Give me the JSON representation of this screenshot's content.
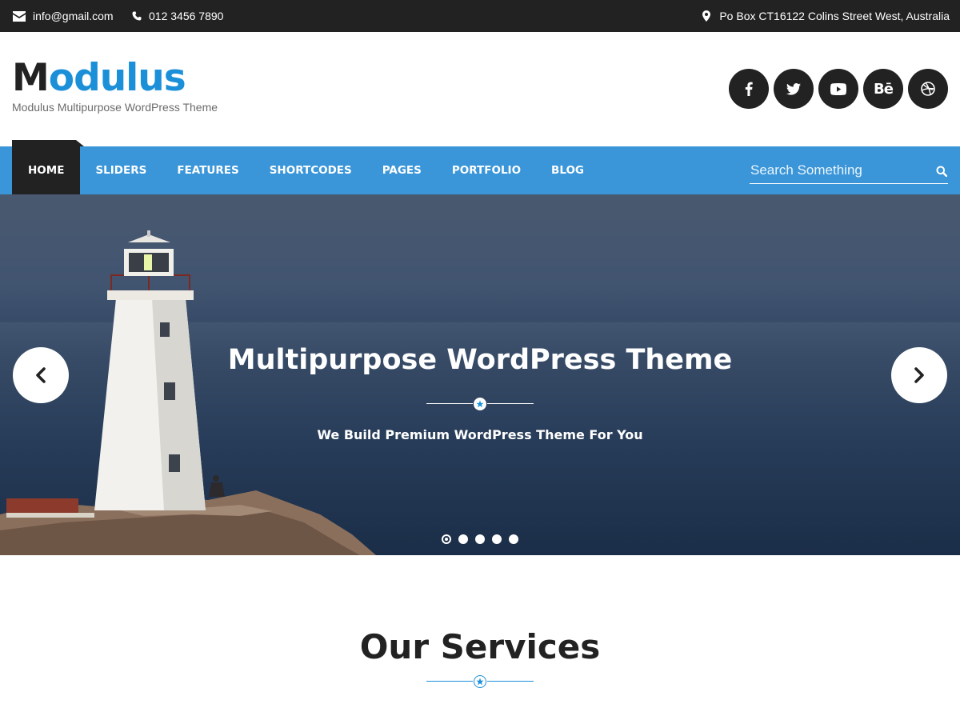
{
  "topbar": {
    "email": "info@gmail.com",
    "phone": "012 3456 7890",
    "address": "Po Box CT16122 Colins Street West, Australia",
    "email_icon": "envelope-icon",
    "phone_icon": "phone-icon",
    "address_icon": "map-marker-icon"
  },
  "header": {
    "logo_first": "M",
    "logo_rest": "odulus",
    "tagline": "Modulus Multipurpose WordPress Theme",
    "social": [
      "facebook-icon",
      "twitter-icon",
      "youtube-icon",
      "behance-icon",
      "dribbble-icon"
    ],
    "behance_glyph": "Bē"
  },
  "nav": {
    "items": [
      "HOME",
      "SLIDERS",
      "FEATURES",
      "SHORTCODES",
      "PAGES",
      "PORTFOLIO",
      "BLOG"
    ],
    "active": "HOME",
    "search_placeholder": "Search Something"
  },
  "hero": {
    "title": "Multipurpose WordPress Theme",
    "subtitle": "We Build Premium WordPress Theme For You",
    "slide_count": 5,
    "active_slide": 1
  },
  "services": {
    "title": "Our Services"
  },
  "colors": {
    "accent": "#3a96d9",
    "logo_blue": "#1b8fd8",
    "dark": "#222222",
    "topbar": "#222222"
  }
}
